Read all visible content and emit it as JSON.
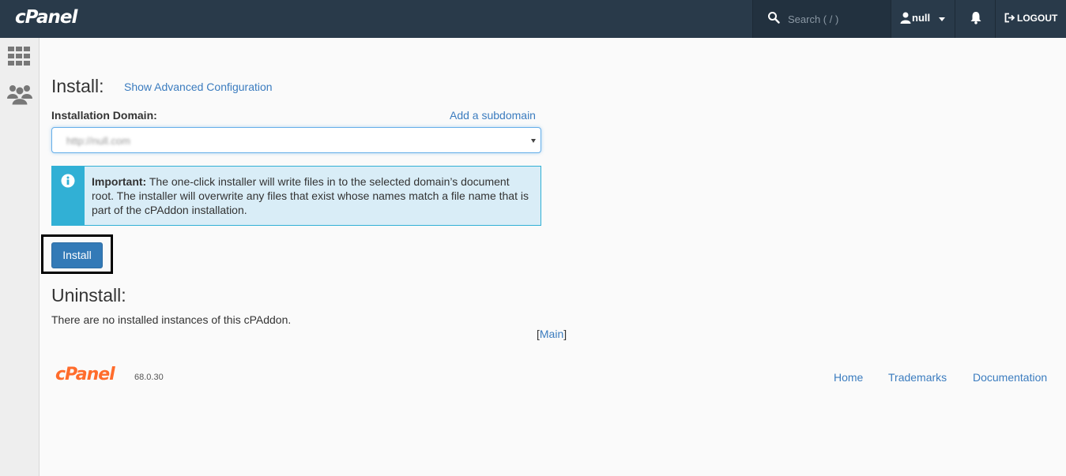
{
  "header": {
    "logo": "cPanel",
    "search_placeholder": "Search ( / )",
    "user": "null",
    "logout": "LOGOUT",
    "icons": {
      "search": "search-icon",
      "user": "user-icon",
      "bell": "bell-icon",
      "logout": "logout-icon"
    }
  },
  "sidebar": {
    "items": [
      {
        "icon": "grid-icon"
      },
      {
        "icon": "users-icon"
      }
    ]
  },
  "install": {
    "title": "Install:",
    "advanced_link": "Show Advanced Configuration",
    "domain_label": "Installation Domain:",
    "subdomain_link": "Add a subdomain",
    "domain_value": "http://null.com",
    "alert_strong": "Important:",
    "alert_text": " The one-click installer will write files in to the selected domain’s document root. The installer will overwrite any files that exist whose names match a file name that is part of the cPAddon installation.",
    "button": "Install"
  },
  "uninstall": {
    "title": "Uninstall:",
    "message": "There are no installed instances of this cPAddon.",
    "main_open": "[",
    "main_link": "Main",
    "main_close": "]"
  },
  "footer": {
    "logo": "cPanel",
    "version": "68.0.30",
    "links": [
      "Home",
      "Trademarks",
      "Documentation"
    ]
  },
  "colors": {
    "topbar": "#293a4a",
    "link": "#3b7cbf",
    "button": "#337ab7",
    "alert_bg": "#d9edf7",
    "alert_accent": "#31b0d5",
    "footer_logo": "#ff6c2c"
  }
}
